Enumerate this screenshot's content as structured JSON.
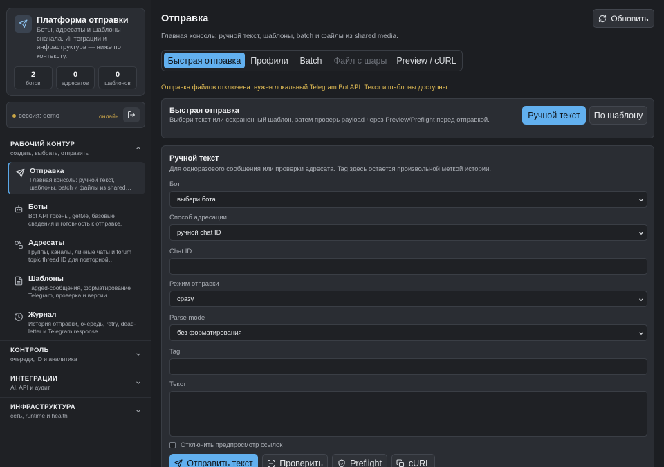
{
  "brand": {
    "title": "Платформа отправки",
    "description": "Боты, адресаты и шаблоны сначала. Интеграции и инфраструктура — ниже по контексту.",
    "stats": [
      {
        "value": "2",
        "label": "ботов"
      },
      {
        "value": "0",
        "label": "адресатов"
      },
      {
        "value": "0",
        "label": "шаблонов"
      }
    ]
  },
  "session": {
    "label": "сессия: demo",
    "status": "онлайн"
  },
  "sections": {
    "work": {
      "title": "РАБОЧИЙ КОНТУР",
      "subtitle": "создать, выбрать, отправить"
    },
    "control": {
      "title": "КОНТРОЛЬ",
      "subtitle": "очереди, ID и аналитика"
    },
    "integrations": {
      "title": "ИНТЕГРАЦИИ",
      "subtitle": "AI, API и аудит"
    },
    "infra": {
      "title": "ИНФРАСТРУКТУРА",
      "subtitle": "сеть, runtime и health"
    }
  },
  "nav": [
    {
      "title": "Отправка",
      "desc": "Главная консоль: ручной текст, шаблоны, batch и файлы из shared…",
      "icon": "send-icon"
    },
    {
      "title": "Боты",
      "desc": "Bot API токены, getMe, базовые сведения и готовность к отправке.",
      "icon": "bot-icon"
    },
    {
      "title": "Адресаты",
      "desc": "Группы, каналы, личные чаты и forum topic thread ID для повторной…",
      "icon": "shapes-icon"
    },
    {
      "title": "Шаблоны",
      "desc": "Tagged-сообщения, форматирование Telegram, проверка и версии.",
      "icon": "document-icon"
    },
    {
      "title": "Журнал",
      "desc": "История отправки, очередь, retry, dead-letter и Telegram response.",
      "icon": "history-icon"
    }
  ],
  "page": {
    "title": "Отправка",
    "subtitle": "Главная консоль: ручной текст, шаблоны, batch и файлы из shared media.",
    "refresh_label": "Обновить"
  },
  "tabs": [
    {
      "label": "Быстрая отправка",
      "state": "active"
    },
    {
      "label": "Профили",
      "state": "normal"
    },
    {
      "label": "Batch",
      "state": "normal"
    },
    {
      "label": "Файл с шары",
      "state": "disabled"
    },
    {
      "label": "Preview / cURL",
      "state": "normal"
    }
  ],
  "warning": "Отправка файлов отключена: нужен локальный Telegram Bot API. Текст и шаблоны доступны.",
  "quick": {
    "title": "Быстрая отправка",
    "subtitle": "Выбери текст или сохраненный шаблон, затем проверь payload через Preview/Preflight перед отправкой.",
    "mode_manual": "Ручной текст",
    "mode_template": "По шаблону"
  },
  "form": {
    "title": "Ручной текст",
    "subtitle": "Для одноразового сообщения или проверки адресата. Tag здесь остается произвольной меткой истории.",
    "bot_label": "Бот",
    "bot_value": "выбери бота",
    "addr_label": "Способ адресации",
    "addr_value": "ручной chat ID",
    "chat_label": "Chat ID",
    "chat_value": "",
    "mode_label": "Режим отправки",
    "mode_value": "сразу",
    "parse_label": "Parse mode",
    "parse_value": "без форматирования",
    "tag_label": "Tag",
    "tag_value": "",
    "text_label": "Текст",
    "disable_preview": "Отключить предпросмотр ссылок",
    "btn_send": "Отправить текст",
    "btn_check": "Проверить",
    "btn_preflight": "Preflight",
    "btn_curl": "cURL"
  },
  "colors": {
    "accent": "#62b0ef",
    "warning": "#e5bf55",
    "status": "#d0a94b"
  }
}
